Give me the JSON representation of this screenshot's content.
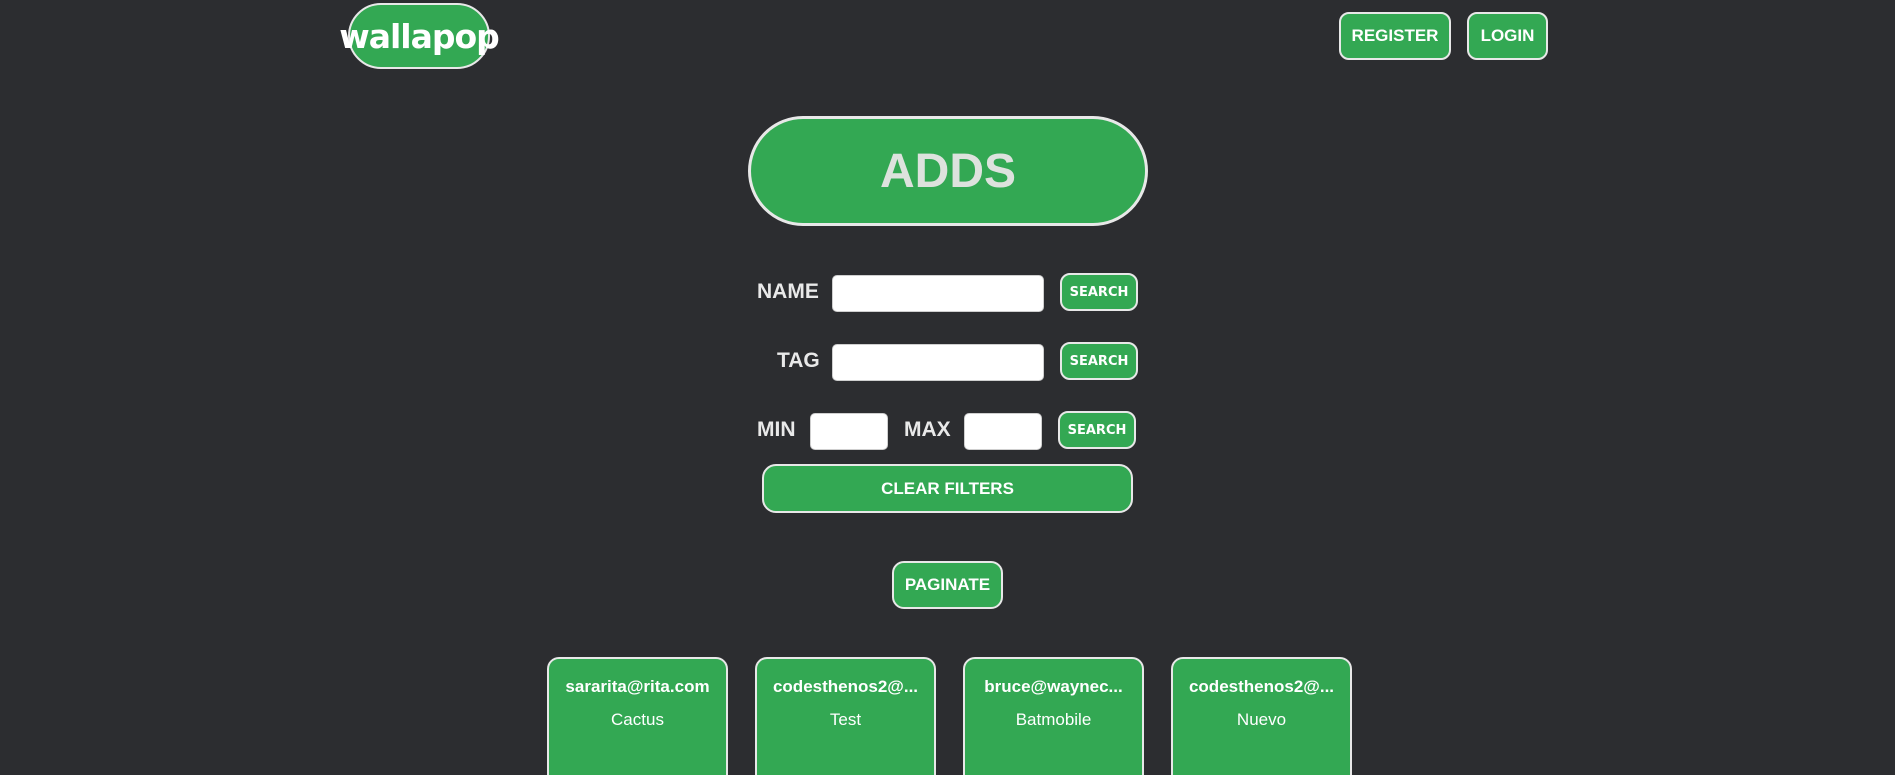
{
  "header": {
    "logo_text": "wallapop",
    "register_label": "REGISTER",
    "login_label": "LOGIN"
  },
  "main": {
    "title": "ADDS"
  },
  "filters": {
    "name_label": "NAME",
    "name_value": "",
    "tag_label": "TAG",
    "tag_value": "",
    "min_label": "MIN",
    "min_value": "",
    "max_label": "MAX",
    "max_value": "",
    "search_label": "SEARCH",
    "clear_label": "CLEAR FILTERS"
  },
  "paginate_label": "PAGINATE",
  "cards": [
    {
      "email": "sararita@rita.com",
      "name": "Cactus"
    },
    {
      "email": "codesthenos2@...",
      "name": "Test"
    },
    {
      "email": "bruce@waynec...",
      "name": "Batmobile"
    },
    {
      "email": "codesthenos2@...",
      "name": "Nuevo"
    }
  ],
  "colors": {
    "background": "#2c2d30",
    "accent_green": "#33a853",
    "border": "#e8e8e8"
  }
}
